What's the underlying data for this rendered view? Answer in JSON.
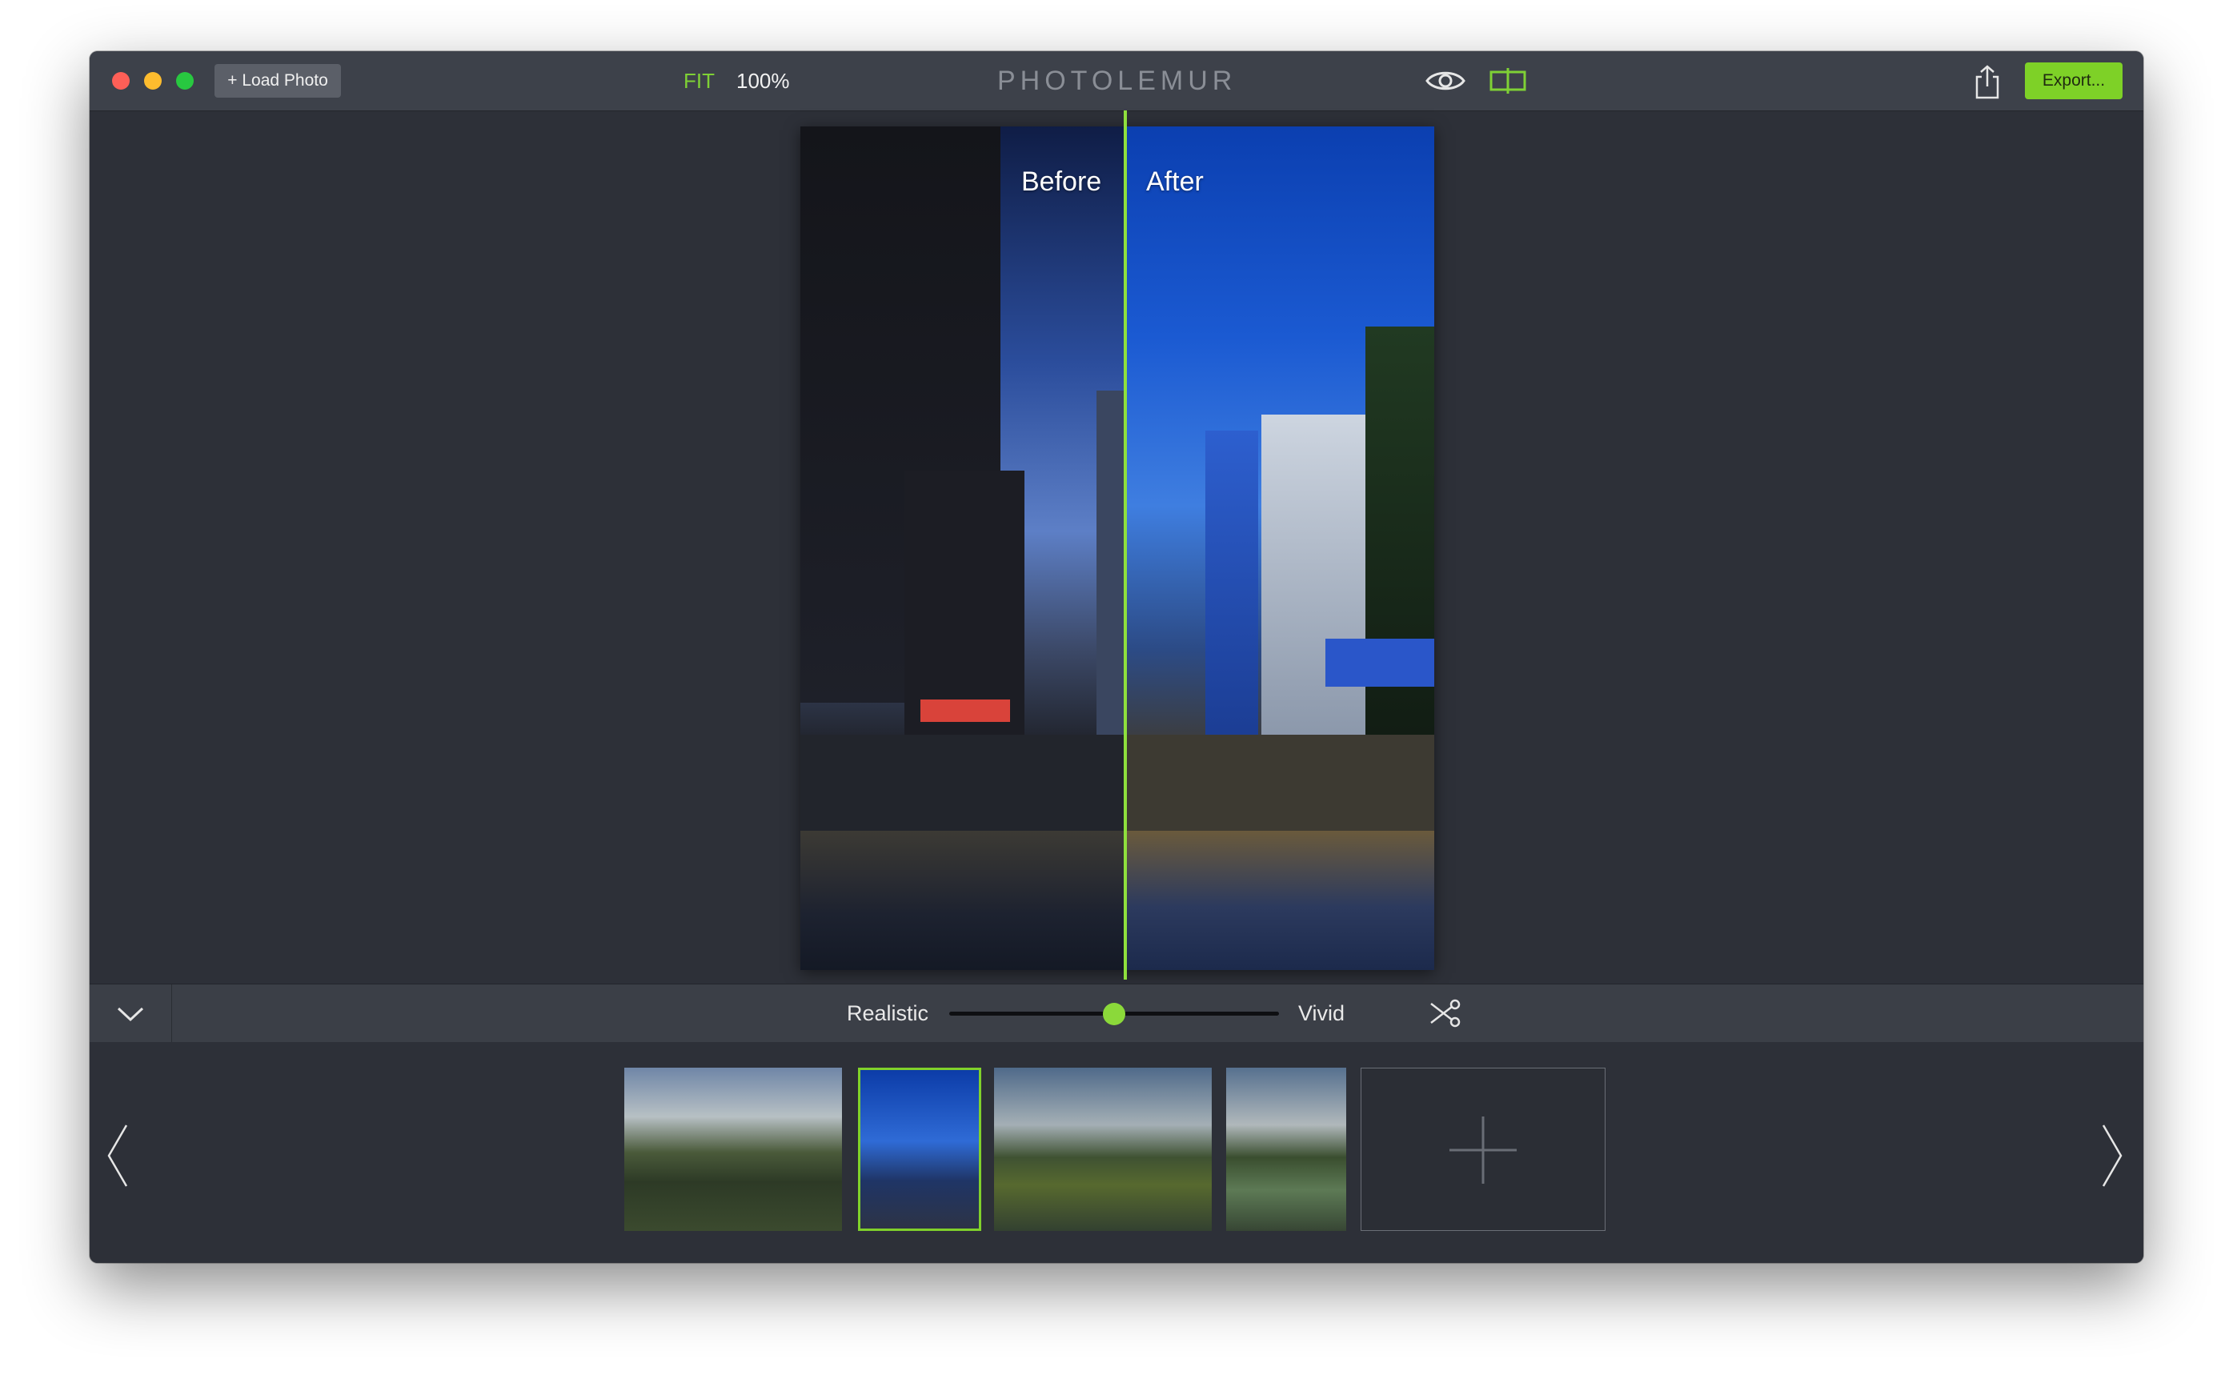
{
  "window": {
    "title": "PHOTOLEMUR"
  },
  "toolbar": {
    "load_photo_label": "+ Load Photo",
    "fit_label": "FIT",
    "zoom_label": "100%",
    "export_label": "Export...",
    "icons": {
      "eye": "eye-icon",
      "compare": "split-compare-icon",
      "share": "share-icon"
    }
  },
  "preview": {
    "before_label": "Before",
    "after_label": "After"
  },
  "controls": {
    "left_label": "Realistic",
    "right_label": "Vivid",
    "slider_value": 0.5,
    "accent_color": "#8bd93a"
  },
  "filmstrip": {
    "thumbnails": [
      {
        "name": "thumbnail-1",
        "selected": false
      },
      {
        "name": "thumbnail-2",
        "selected": true
      },
      {
        "name": "thumbnail-3",
        "selected": false
      },
      {
        "name": "thumbnail-4",
        "selected": false
      }
    ],
    "add_slot_icon": "plus-icon",
    "prev_icon": "chevron-left-icon",
    "next_icon": "chevron-right-icon"
  },
  "colors": {
    "accent": "#7ed127",
    "background": "#2d3038",
    "toolbar": "#3d414a"
  }
}
